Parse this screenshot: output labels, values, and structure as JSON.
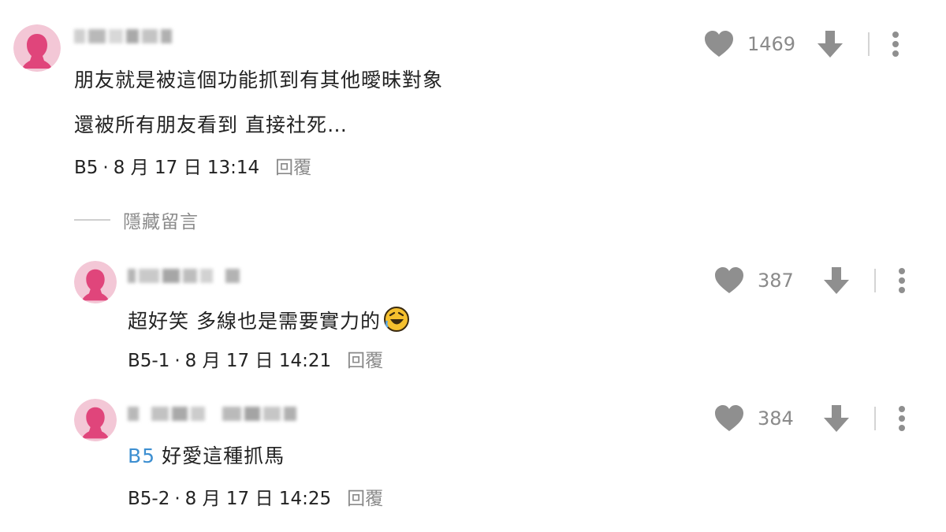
{
  "comments": [
    {
      "floor": "B5",
      "text_lines": [
        "朋友就是被這個功能抓到有其他曖昧對象",
        "還被所有朋友看到 直接社死…"
      ],
      "date": "8 月 17 日 13:14",
      "reply_label": "回覆",
      "likes": "1469"
    },
    {
      "floor": "B5-1",
      "text_lines": [
        "超好笑 多線也是需要實力的"
      ],
      "emoji": "rolling-on-floor-laughing-emoji",
      "date": "8 月 17 日 14:21",
      "reply_label": "回覆",
      "likes": "387"
    },
    {
      "floor": "B5-2",
      "mention": "B5",
      "text_lines": [
        "好愛這種抓馬"
      ],
      "date": "8 月 17 日 14:25",
      "reply_label": "回覆",
      "likes": "384"
    }
  ],
  "hidden_toggle": {
    "label": "隱藏留言"
  },
  "colors": {
    "avatar_bg": "#f3c7d6",
    "avatar_figure": "#e0457b",
    "icon_gray": "#8f8f8f",
    "mention": "#3d8fd1",
    "muted_text": "#8a8a8a"
  },
  "icons": {
    "like": "heart-icon",
    "dislike": "arrow-down-icon",
    "more": "more-vertical-icon",
    "avatar": "female-silhouette-icon"
  }
}
